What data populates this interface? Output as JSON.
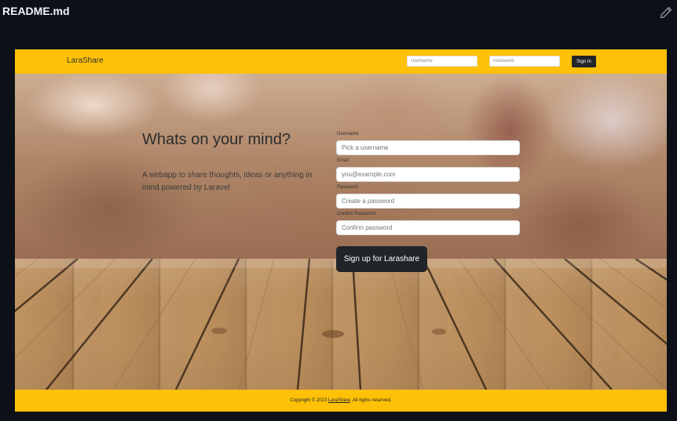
{
  "readme": {
    "title": "README.md",
    "edit_icon": "pencil-icon"
  },
  "navbar": {
    "brand": "LaraShare",
    "username_placeholder": "Username",
    "password_placeholder": "Password",
    "signin_label": "Sign In"
  },
  "hero": {
    "headline": "Whats on your mind?",
    "tagline": "A webapp to share thoughts, ideas or anything in mind powered by Laravel"
  },
  "form": {
    "username_label": "Username",
    "username_placeholder": "Pick a username",
    "email_label": "Email",
    "email_placeholder": "you@example.com",
    "password_label": "Password",
    "password_placeholder": "Create a password",
    "confirm_label": "Confirm Password",
    "confirm_placeholder": "Confirm password",
    "submit_label": "Sign up for Larashare"
  },
  "footer": {
    "prefix": "Copyright © 2023",
    "link": "LaraShare",
    "suffix": ". All rights reserved."
  },
  "colors": {
    "accent": "#ffc107",
    "dark": "#212529",
    "page_bg": "#0d1117"
  }
}
